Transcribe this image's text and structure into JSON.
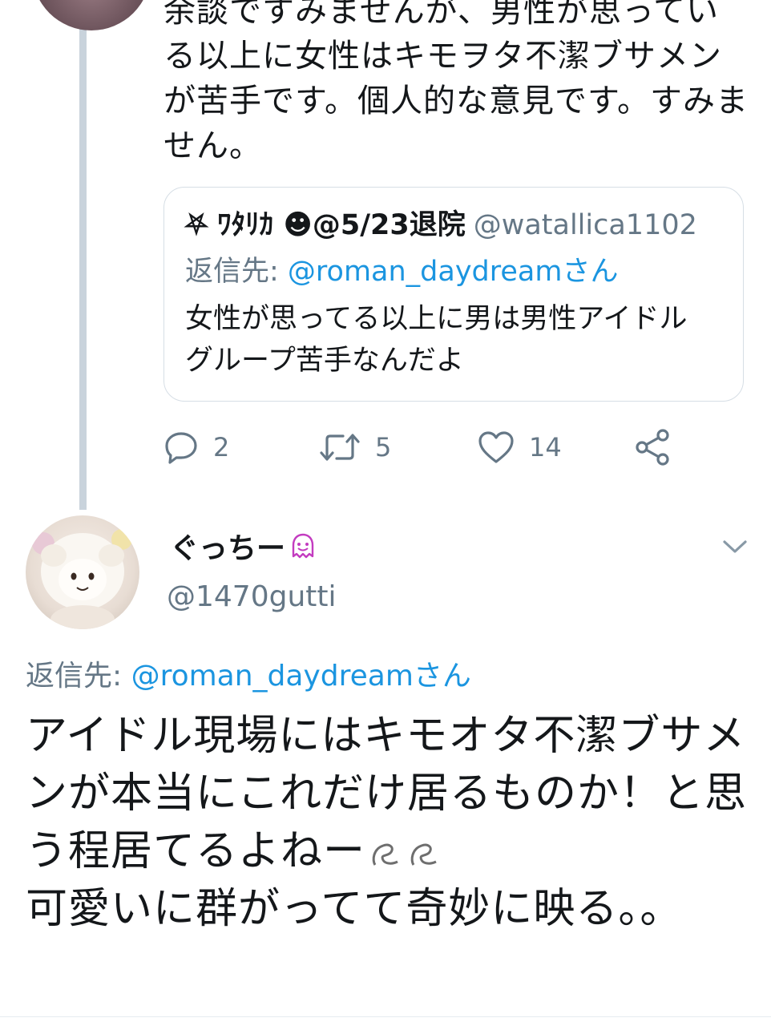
{
  "top_tweet": {
    "text": "余談ですみませんが、男性が思っている以上に女性はキモヲタ不潔ブサメンが苦手です。個人的な意見です。すみません。"
  },
  "quote": {
    "name": "⛧ ﾜﾀﾘｶ ☻@5/23退院",
    "handle": "@watallica1102",
    "reply_prefix": "返信先: ",
    "reply_mention": "@roman_daydreamさん",
    "body": "女性が思ってる以上に男は男性アイドルグループ苦手なんだよ"
  },
  "actions": {
    "reply_count": "2",
    "retweet_count": "5",
    "like_count": "14",
    "icons": [
      "reply-icon",
      "retweet-icon",
      "like-icon",
      "share-icon"
    ]
  },
  "tweet2": {
    "name": "ぐっちー",
    "handle": "@1470gutti",
    "reply_prefix": "返信先: ",
    "reply_mention": "@roman_daydreamさん",
    "body": "アイドル現場にはキモオタ不潔ブサメンが本当にこれだけ居るものか！と思う程居てるよねー",
    "body_cont": "可愛いに群がってて奇妙に映る。。"
  },
  "colors": {
    "muted": "#657786",
    "link": "#1b95e0",
    "thread_line": "#c9d3dc",
    "name_emoji": "#c33cc0"
  }
}
